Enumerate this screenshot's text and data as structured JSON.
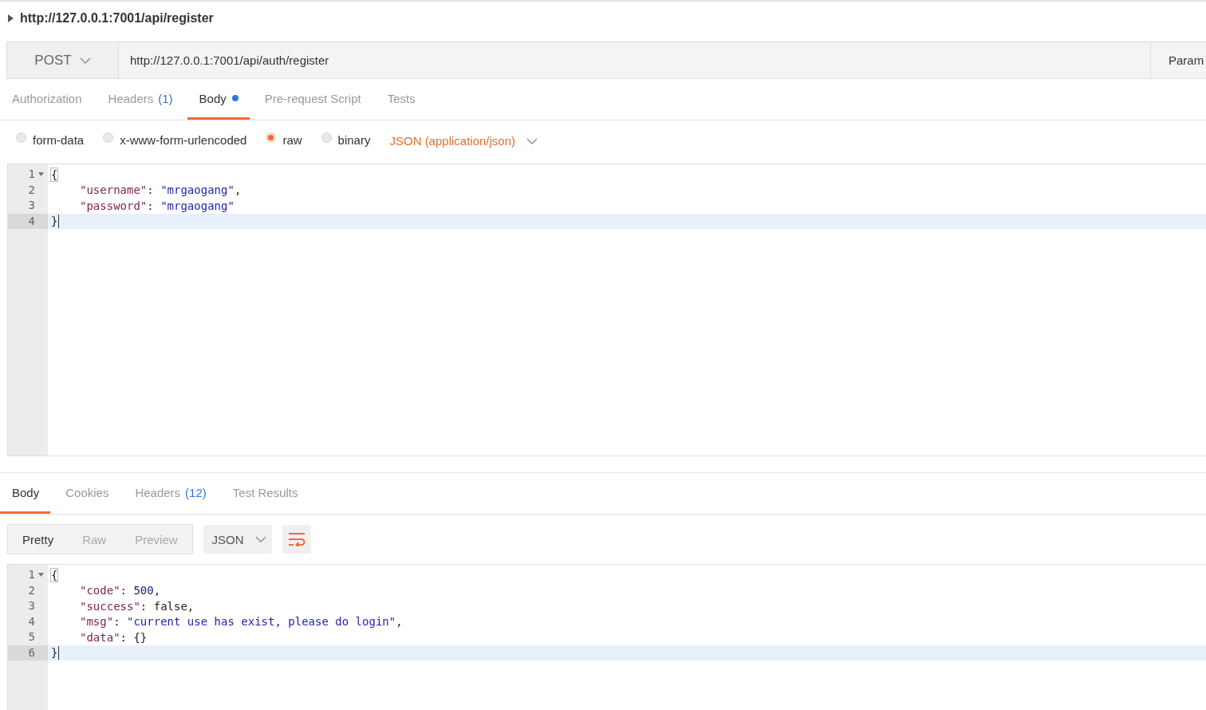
{
  "request": {
    "title": "http://127.0.0.1:7001/api/register",
    "method": "POST",
    "url": "http://127.0.0.1:7001/api/auth/register",
    "params_button": "Param"
  },
  "request_tabs": [
    {
      "label": "Authorization",
      "selected": false
    },
    {
      "label": "Headers",
      "count": "(1)",
      "selected": false
    },
    {
      "label": "Body",
      "dot": true,
      "selected": true
    },
    {
      "label": "Pre-request Script",
      "selected": false
    },
    {
      "label": "Tests",
      "selected": false
    }
  ],
  "body_types": [
    {
      "label": "form-data",
      "selected": false
    },
    {
      "label": "x-www-form-urlencoded",
      "selected": false
    },
    {
      "label": "raw",
      "selected": true
    },
    {
      "label": "binary",
      "selected": false
    }
  ],
  "content_type": "JSON (application/json)",
  "request_body": [
    {
      "num": "1",
      "fold": true,
      "active": false,
      "indented": false,
      "tokens": [
        {
          "kind": "punct",
          "text": "{",
          "matched": true
        }
      ]
    },
    {
      "num": "2",
      "fold": false,
      "active": false,
      "indented": true,
      "tokens": [
        {
          "kind": "key",
          "text": "\"username\""
        },
        {
          "kind": "punct",
          "text": ": "
        },
        {
          "kind": "string",
          "text": "\"mrgaogang\""
        },
        {
          "kind": "punct",
          "text": ","
        }
      ]
    },
    {
      "num": "3",
      "fold": false,
      "active": false,
      "indented": true,
      "tokens": [
        {
          "kind": "key",
          "text": "\"password\""
        },
        {
          "kind": "punct",
          "text": ": "
        },
        {
          "kind": "string",
          "text": "\"mrgaogang\""
        }
      ]
    },
    {
      "num": "4",
      "fold": false,
      "active": true,
      "indented": false,
      "tokens": [
        {
          "kind": "punct",
          "text": "}",
          "matched": false
        }
      ]
    }
  ],
  "response_tabs": [
    {
      "label": "Body",
      "selected": true
    },
    {
      "label": "Cookies",
      "selected": false
    },
    {
      "label": "Headers",
      "count": "(12)",
      "selected": false
    },
    {
      "label": "Test Results",
      "selected": false
    }
  ],
  "view_modes": [
    {
      "label": "Pretty",
      "selected": true
    },
    {
      "label": "Raw",
      "selected": false
    },
    {
      "label": "Preview",
      "selected": false
    }
  ],
  "response_format": "JSON",
  "response_body": [
    {
      "num": "1",
      "fold": true,
      "active": false,
      "indented": false,
      "tokens": [
        {
          "kind": "punct",
          "text": "{",
          "matched": true
        }
      ]
    },
    {
      "num": "2",
      "fold": false,
      "active": false,
      "indented": true,
      "tokens": [
        {
          "kind": "key",
          "text": "\"code\""
        },
        {
          "kind": "punct",
          "text": ": "
        },
        {
          "kind": "number",
          "text": "500"
        },
        {
          "kind": "punct",
          "text": ","
        }
      ]
    },
    {
      "num": "3",
      "fold": false,
      "active": false,
      "indented": true,
      "tokens": [
        {
          "kind": "key",
          "text": "\"success\""
        },
        {
          "kind": "punct",
          "text": ": false,"
        }
      ]
    },
    {
      "num": "4",
      "fold": false,
      "active": false,
      "indented": true,
      "tokens": [
        {
          "kind": "key",
          "text": "\"msg\""
        },
        {
          "kind": "punct",
          "text": ": "
        },
        {
          "kind": "string",
          "text": "\"current use has exist, please do login\""
        },
        {
          "kind": "punct",
          "text": ","
        }
      ]
    },
    {
      "num": "5",
      "fold": false,
      "active": false,
      "indented": true,
      "tokens": [
        {
          "kind": "key",
          "text": "\"data\""
        },
        {
          "kind": "punct",
          "text": ": {}"
        }
      ]
    },
    {
      "num": "6",
      "fold": false,
      "active": true,
      "indented": false,
      "tokens": [
        {
          "kind": "punct",
          "text": "}",
          "matched": false
        }
      ]
    }
  ]
}
